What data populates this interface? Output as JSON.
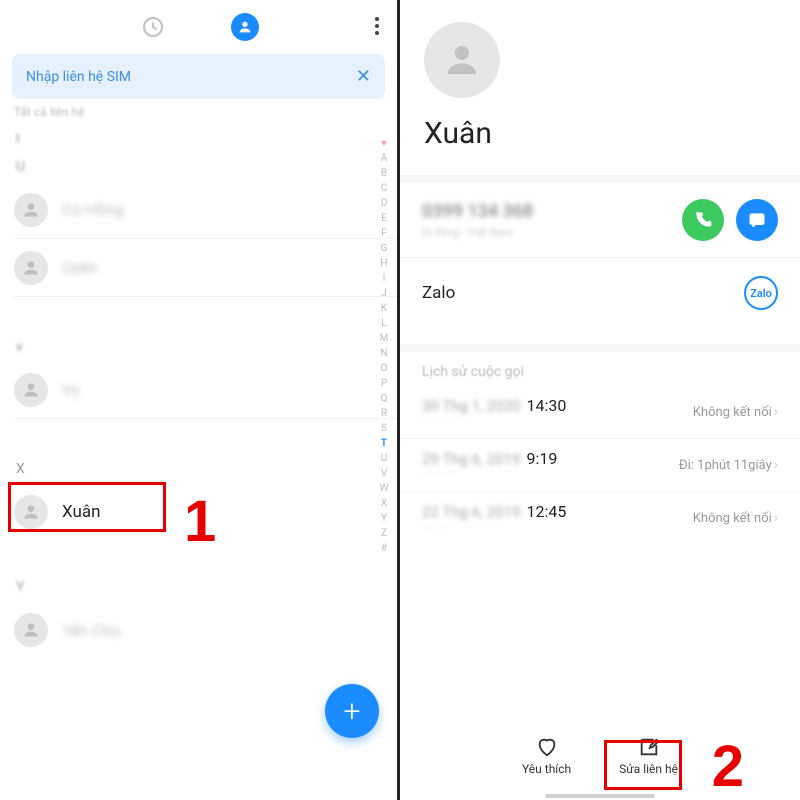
{
  "left": {
    "sim_banner": "Nhập liên hệ SIM",
    "filter_label": "Tất cả liên hệ",
    "sections": {
      "blur1_letter": "I",
      "blur2_letter": "U",
      "x_letter": "X",
      "y_letter": "Y"
    },
    "contacts_blur": [
      "Cò Hồng",
      "Uyên",
      "Vy",
      "Yến Chu"
    ],
    "contact_x": "Xuân",
    "alpha_index": [
      "A",
      "B",
      "C",
      "D",
      "E",
      "F",
      "G",
      "H",
      "I",
      "J",
      "K",
      "L",
      "M",
      "N",
      "O",
      "P",
      "Q",
      "R",
      "S",
      "T",
      "U",
      "V",
      "W",
      "X",
      "Y",
      "Z",
      "#"
    ],
    "step1": "1"
  },
  "right": {
    "name": "Xuân",
    "phone_blur": "0399 134 368",
    "phone_sub": "Di động · Việt Nam",
    "zalo": "Zalo",
    "zalo_badge": "Zalo",
    "history_label": "Lịch sử cuộc gọi",
    "calls": [
      {
        "date_blur": "30 Thg 1, 2020",
        "time": "14:30",
        "status": "Không kết nối"
      },
      {
        "date_blur": "29 Thg 6, 2019",
        "time": "9:19",
        "status": "Đi: 1phút 11giây"
      },
      {
        "date_blur": "22 Thg 6, 2019",
        "time": "12:45",
        "status": "Không kết nối"
      }
    ],
    "fav_label": "Yêu thích",
    "edit_label": "Sửa liên hệ",
    "step2": "2"
  }
}
